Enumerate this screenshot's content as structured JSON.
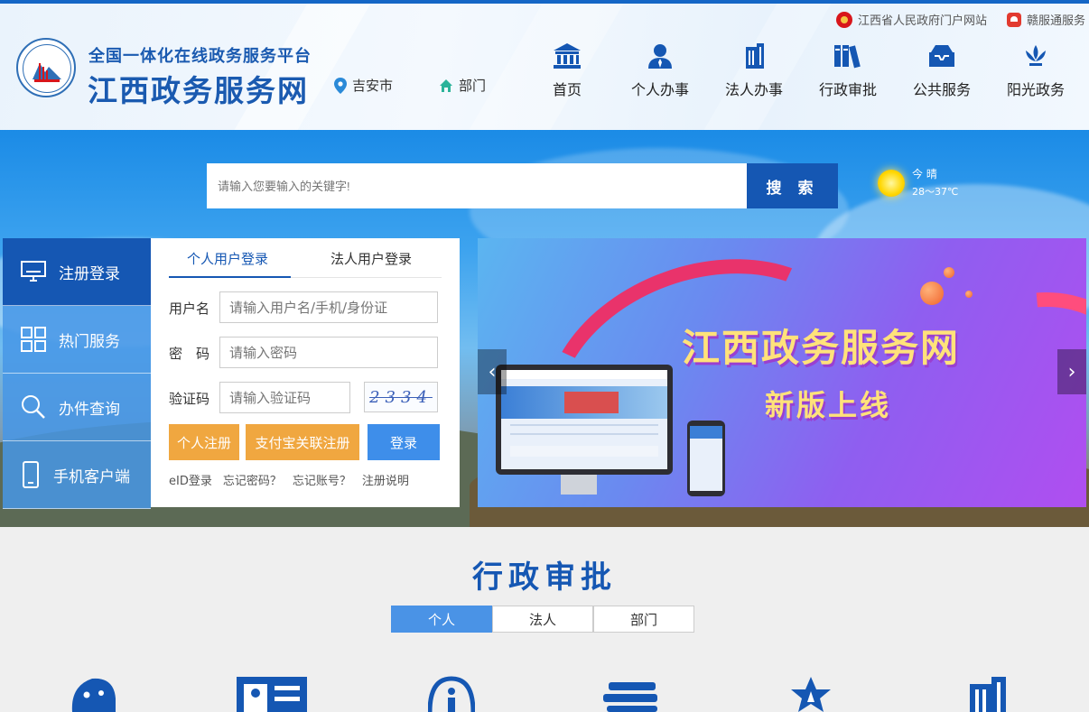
{
  "header": {
    "ext_links": [
      "江西省人民政府门户网站",
      "赣服通服务"
    ],
    "site_subtitle": "全国一体化在线政务服务平台",
    "site_title": "江西政务服务网",
    "location": "吉安市",
    "department": "部门",
    "nav": [
      {
        "label": "首页",
        "icon": "bank-icon"
      },
      {
        "label": "个人办事",
        "icon": "person-icon"
      },
      {
        "label": "法人办事",
        "icon": "building-icon"
      },
      {
        "label": "行政审批",
        "icon": "books-icon"
      },
      {
        "label": "公共服务",
        "icon": "inbox-icon"
      },
      {
        "label": "阳光政务",
        "icon": "lotus-icon"
      }
    ]
  },
  "search": {
    "placeholder": "请输入您要输入的关键字!",
    "button": "搜 索"
  },
  "weather": {
    "day": "今 晴",
    "temp": "28～37℃"
  },
  "side_menu": [
    {
      "label": "注册登录",
      "icon": "monitor-icon",
      "active": true
    },
    {
      "label": "热门服务",
      "icon": "grid-icon",
      "active": false
    },
    {
      "label": "办件查询",
      "icon": "magnifier-icon",
      "active": false
    },
    {
      "label": "手机客户端",
      "icon": "phone-icon",
      "active": false
    }
  ],
  "login": {
    "tabs": [
      "个人用户登录",
      "法人用户登录"
    ],
    "username_label": "用户名",
    "username_placeholder": "请输入用户名/手机/身份证",
    "password_label": "密　码",
    "password_placeholder": "请输入密码",
    "captcha_label": "验证码",
    "captcha_placeholder": "请输入验证码",
    "captcha_text": "2334",
    "register_button": "个人注册",
    "alipay_button": "支付宝关联注册",
    "login_button": "登录",
    "links": [
      "eID登录",
      "忘记密码？",
      "忘记账号？",
      "注册说明"
    ]
  },
  "banner": {
    "title": "江西政务服务网",
    "subtitle": "新版上线",
    "prev": "‹",
    "next": "›"
  },
  "approval": {
    "title": "行政审批",
    "tabs": [
      "个人",
      "法人",
      "部门"
    ],
    "active_tab": "个人"
  },
  "colors": {
    "brand_blue": "#1557b3",
    "accent_orange": "#f0a740",
    "button_blue": "#3e8eea"
  }
}
